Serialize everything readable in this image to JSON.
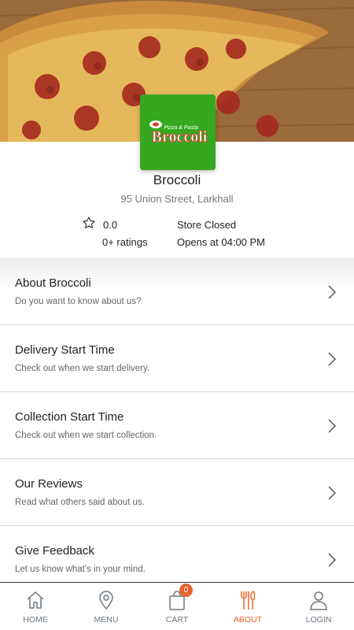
{
  "store": {
    "logo_line1": "Pizza & Pasta",
    "logo_line2": "Broccoli",
    "name": "Broccoli",
    "address": "95 Union Street, Larkhall",
    "rating": "0.0",
    "ratings_count": "0+ ratings",
    "status": "Store Closed",
    "opens_at": "Opens at 04:00 PM"
  },
  "list": [
    {
      "title": "About Broccoli",
      "subtitle": "Do you want to know about us?"
    },
    {
      "title": "Delivery Start Time",
      "subtitle": "Check out when we start delivery."
    },
    {
      "title": "Collection Start Time",
      "subtitle": "Check out when we start collection."
    },
    {
      "title": "Our Reviews",
      "subtitle": "Read what others said about us."
    },
    {
      "title": "Give Feedback",
      "subtitle": "Let us know what's in your mind."
    }
  ],
  "tabbar": {
    "home": "HOME",
    "menu": "MENU",
    "cart": "CART",
    "cart_count": "0",
    "about": "ABOUT",
    "login": "LOGIN"
  },
  "colors": {
    "accent": "#e8622c",
    "logo_bg": "#35a81f",
    "tab_inactive": "#6e7781"
  },
  "icons": [
    "star-icon",
    "chevron-right-icon",
    "home-icon",
    "map-pin-icon",
    "shopping-bag-icon",
    "fork-knife-icon",
    "user-icon"
  ]
}
